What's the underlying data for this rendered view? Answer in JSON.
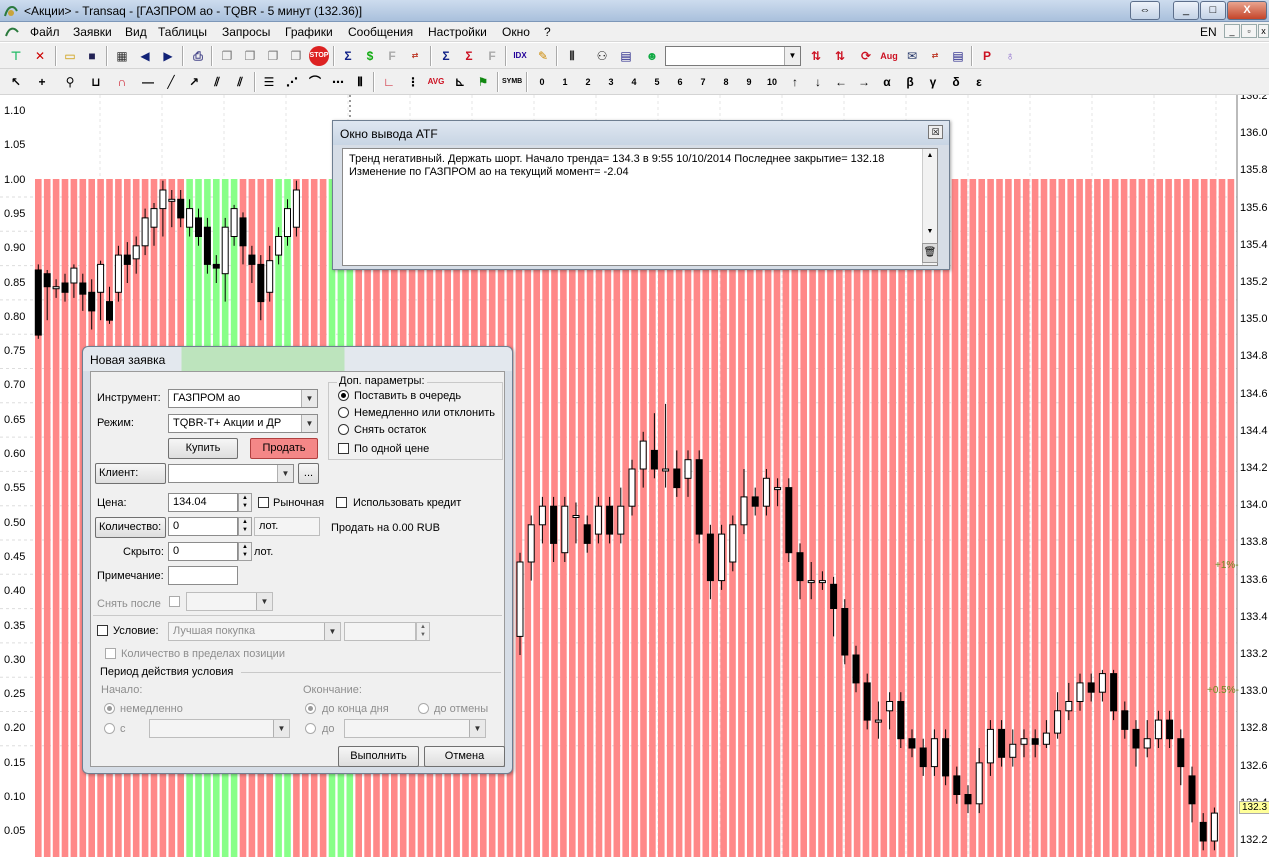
{
  "window": {
    "title": "<Акции> - Transaq - [ГАЗПРОМ ао - TQBR - 5 минут (132.36)]",
    "lang": "EN",
    "controls": {
      "restore": "⇔",
      "minimize": "_",
      "maximize": "□",
      "close": "X"
    }
  },
  "menu": [
    "Файл",
    "Заявки",
    "Вид",
    "Таблицы",
    "Запросы",
    "Графики",
    "Сообщения",
    "Настройки",
    "Окно",
    "?"
  ],
  "toolbar1": [
    "new-order-icon",
    "cancel-order-icon",
    "open-icon",
    "save-icon",
    "table-icon",
    "back-arrow-icon",
    "forward-arrow-icon",
    "print-icon",
    "copy-icon",
    "copy2-icon",
    "paste-icon",
    "paste2-icon",
    "stop-icon",
    "sigma-icon",
    "dollar-icon",
    "fs-icon",
    "exchange-icon",
    "sum-p-icon",
    "sum-l-icon",
    "f-icon",
    "idx-icon",
    "pencil-icon",
    "bars-icon",
    "binoculars-icon",
    "table-edit-icon",
    "people-icon"
  ],
  "toolbar1_right": [
    "arrows-red-icon",
    "arrows-red2-icon",
    "refresh-icon",
    "aug-icon",
    "news-icon",
    "exchange2-icon",
    "notes-icon",
    "p-icon",
    "cup-icon"
  ],
  "toolbar2": {
    "tools": [
      "pointer-icon",
      "crosshair-icon",
      "zoom-icon",
      "ruler-icon",
      "magnet-icon",
      "hline-icon",
      "trendline-icon",
      "ray-icon",
      "channel-icon",
      "parallel-icon",
      "fib-icon",
      "fan-icon",
      "arc-icon",
      "timezones-icon",
      "lcross-icon",
      "speed-icon",
      "aug-label-icon",
      "gann-icon",
      "symbol-icon"
    ],
    "waves": [
      "0",
      "1",
      "2",
      "3",
      "4",
      "5",
      "6",
      "7",
      "8",
      "9",
      "10"
    ],
    "marks": [
      "↑",
      "↓",
      "←",
      "→",
      "α",
      "β",
      "γ",
      "δ",
      "ε"
    ]
  },
  "chart": {
    "left_axis": [
      "1.10",
      "1.05",
      "1.00",
      "0.95",
      "0.90",
      "0.85",
      "0.80",
      "0.75",
      "0.70",
      "0.65",
      "0.60",
      "0.55",
      "0.50",
      "0.45",
      "0.40",
      "0.35",
      "0.30",
      "0.25",
      "0.20",
      "0.15",
      "0.10",
      "0.05"
    ],
    "right_axis": [
      "136.2",
      "136.0",
      "135.8",
      "135.6",
      "135.4",
      "135.2",
      "135.0",
      "134.8",
      "134.6",
      "134.4",
      "134.2",
      "134.0",
      "133.8",
      "133.6",
      "133.4",
      "133.2",
      "133.0",
      "132.8",
      "132.6",
      "132.4",
      "132.2"
    ],
    "last_price_tag": "132.3",
    "annotations": [
      "+1%-",
      "+0.5%-"
    ],
    "colors": {
      "bear": "#ff8888",
      "bull": "#88ff88",
      "candle_up": "#ffffff",
      "candle_down": "#000000"
    }
  },
  "atf": {
    "title": "Окно вывода ATF",
    "line1": "Тренд негативный. Держать шорт. Начало тренда= 134.3    в 9:55 10/10/2014 Последнее закрытие= 132.18",
    "line2": "Изменение по ГАЗПРОМ ао на текущий момент= -2.04"
  },
  "order": {
    "title": "Новая заявка",
    "instrument_label": "Инструмент:",
    "instrument_value": "ГАЗПРОМ ао",
    "mode_label": "Режим:",
    "mode_value": "TQBR-T+ Акции и ДР",
    "buy": "Купить",
    "sell": "Продать",
    "extra_params": "Доп. параметры:",
    "opt_queue": "Поставить в очередь",
    "opt_immediate": "Немедленно или отклонить",
    "opt_cancel_rest": "Снять остаток",
    "opt_single_price": "По одной цене",
    "client_label": "Клиент:",
    "client_value": "",
    "browse": "...",
    "price_label": "Цена:",
    "price_value": "134.04",
    "market": "Рыночная",
    "use_credit": "Использовать кредит",
    "qty_label": "Количество:",
    "qty_value": "0",
    "lots": "лот.",
    "sell_info": "Продать на 0.00 RUB",
    "hidden_label": "Скрыто:",
    "hidden_value": "0",
    "note_label": "Примечание:",
    "note_value": "",
    "remove_after": "Снять после",
    "condition": "Условие:",
    "condition_value": "Лучшая покупка",
    "qty_in_position": "Количество в пределах позиции",
    "period": "Период действия условия",
    "start": "Начало:",
    "end": "Окончание:",
    "immediately": "немедленно",
    "since": "с",
    "until_day_end": "до конца дня",
    "until_cancel": "до отмены",
    "until": "до",
    "execute": "Выполнить",
    "cancel": "Отмена"
  }
}
